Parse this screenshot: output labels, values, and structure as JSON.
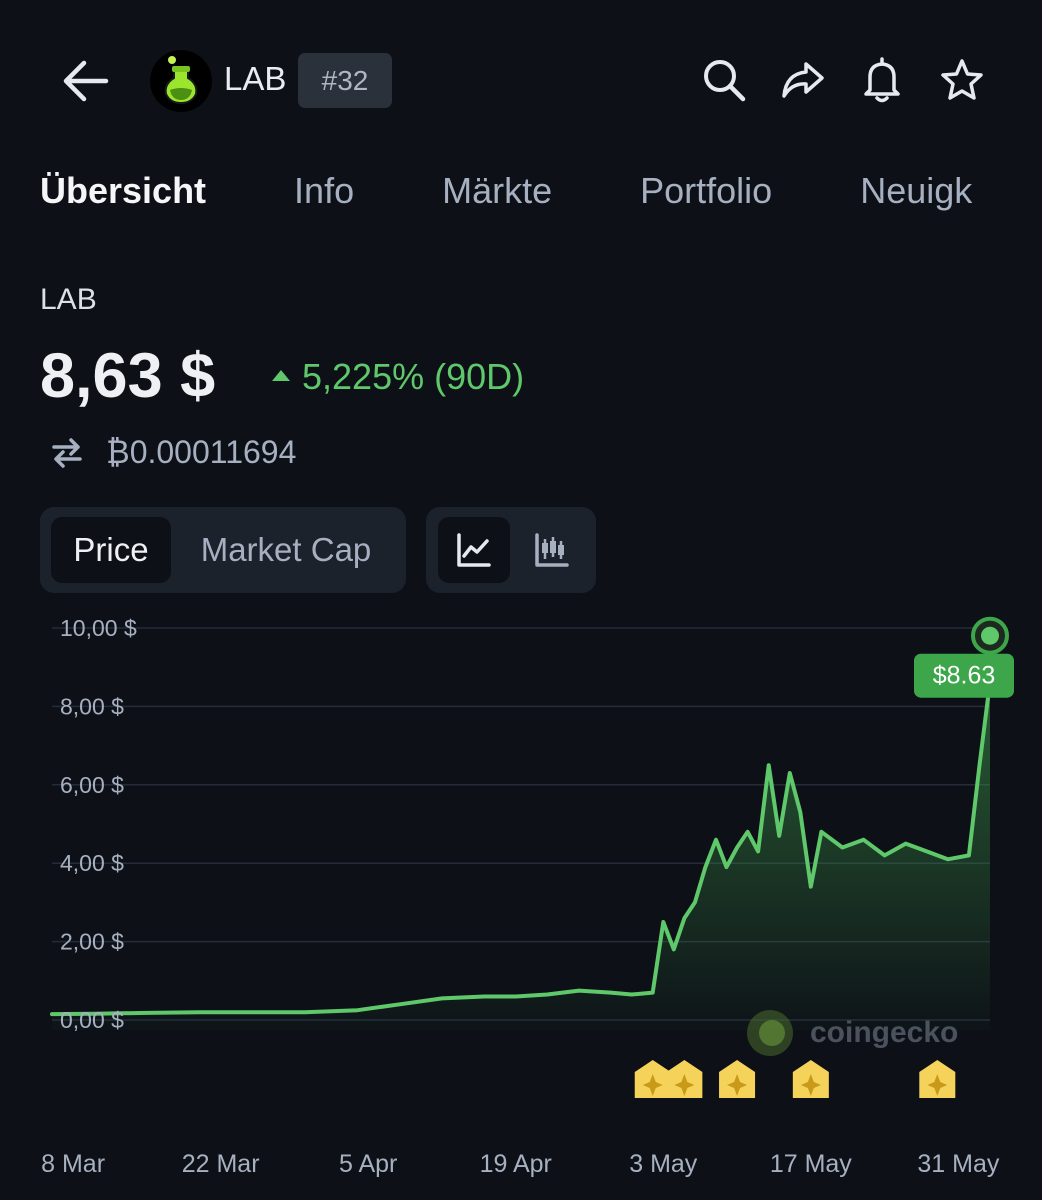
{
  "header": {
    "coin_symbol": "LAB",
    "rank_badge": "#32",
    "icons": [
      "back-arrow-icon",
      "coin-logo-icon",
      "search-icon",
      "share-icon",
      "bell-icon",
      "star-icon"
    ]
  },
  "tabs": [
    {
      "label": "Übersicht",
      "active": true
    },
    {
      "label": "Info",
      "active": false
    },
    {
      "label": "Märkte",
      "active": false
    },
    {
      "label": "Portfolio",
      "active": false
    },
    {
      "label": "Neuigk",
      "active": false
    }
  ],
  "price_block": {
    "coin_label": "LAB",
    "price": "8,63 $",
    "change": "5,225% (90D)",
    "btc_value": "₿0.00011694"
  },
  "controls": {
    "price_label": "Price",
    "market_cap_label": "Market Cap",
    "selected_metric": "Price",
    "selected_chart_style": "line"
  },
  "colors": {
    "background": "#0d1117",
    "accent_green": "#5ec86a",
    "tooltip_green": "#3da64a",
    "event_marker": "#f5d35a"
  },
  "watermark": "coingecko",
  "chart_data": {
    "type": "line",
    "current_value_label": "$8.63",
    "y_tick_labels": [
      "10,00 $",
      "8,00 $",
      "6,00 $",
      "4,00 $",
      "2,00 $",
      "0,00 $"
    ],
    "y_ticks": [
      10,
      8,
      6,
      4,
      2,
      0
    ],
    "ylim": [
      0,
      10
    ],
    "x_tick_labels": [
      "8 Mar",
      "22 Mar",
      "5 Apr",
      "19 Apr",
      "3 May",
      "17 May",
      "31 May"
    ],
    "x_ticks": [
      "2025-03-08",
      "2025-03-22",
      "2025-04-05",
      "2025-04-19",
      "2025-05-03",
      "2025-05-17",
      "2025-05-31"
    ],
    "x": [
      "2025-03-06",
      "2025-03-10",
      "2025-03-15",
      "2025-03-20",
      "2025-03-25",
      "2025-03-30",
      "2025-04-04",
      "2025-04-08",
      "2025-04-12",
      "2025-04-16",
      "2025-04-19",
      "2025-04-22",
      "2025-04-25",
      "2025-04-28",
      "2025-04-30",
      "2025-05-02",
      "2025-05-03",
      "2025-05-04",
      "2025-05-05",
      "2025-05-06",
      "2025-05-07",
      "2025-05-08",
      "2025-05-09",
      "2025-05-10",
      "2025-05-11",
      "2025-05-12",
      "2025-05-13",
      "2025-05-14",
      "2025-05-15",
      "2025-05-16",
      "2025-05-17",
      "2025-05-18",
      "2025-05-20",
      "2025-05-22",
      "2025-05-24",
      "2025-05-26",
      "2025-05-28",
      "2025-05-30",
      "2025-06-01",
      "2025-06-02",
      "2025-06-03"
    ],
    "values": [
      0.15,
      0.16,
      0.18,
      0.2,
      0.2,
      0.2,
      0.25,
      0.4,
      0.55,
      0.6,
      0.6,
      0.65,
      0.75,
      0.7,
      0.65,
      0.7,
      2.5,
      1.8,
      2.6,
      3.0,
      3.9,
      4.6,
      3.9,
      4.4,
      4.8,
      4.3,
      6.5,
      4.7,
      6.3,
      5.3,
      3.4,
      4.8,
      4.4,
      4.6,
      4.2,
      4.5,
      4.3,
      4.1,
      4.2,
      6.5,
      8.63
    ],
    "event_markers": [
      "2025-05-02",
      "2025-05-05",
      "2025-05-10",
      "2025-05-17",
      "2025-05-29"
    ],
    "grid": true
  }
}
